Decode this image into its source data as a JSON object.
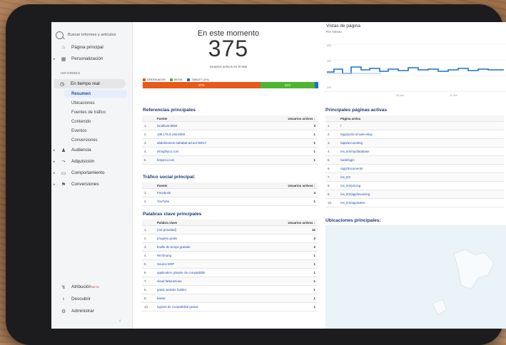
{
  "sidebar": {
    "search_placeholder": "Buscar informes y artículos",
    "home": "Página principal",
    "customization": "Personalización",
    "section_label": "INFORMES",
    "realtime": "En tiempo real",
    "realtime_sub": [
      "Resumen",
      "Ubicaciones",
      "Fuentes de tráfico",
      "Contenido",
      "Eventos",
      "Conversiones"
    ],
    "audience": "Audiencia",
    "acquisition": "Adquisición",
    "behavior": "Comportamiento",
    "conversions": "Conversiones",
    "attribution": "Atribución",
    "attribution_badge": "BETA",
    "discover": "Descubrir",
    "admin": "Administrar"
  },
  "realtime": {
    "title": "En este momento",
    "active_users": "375",
    "caption": "usuarios activos en el sitio",
    "devices": [
      {
        "label": "ORDENADOR",
        "color": "#e8591a",
        "percent": 67,
        "percent_label": "67%"
      },
      {
        "label": "MÓVIL",
        "color": "#50b432",
        "percent": 31,
        "percent_label": "31%"
      },
      {
        "label": "TABLET (2%)",
        "color": "#1a73c9",
        "percent": 2,
        "percent_label": ""
      }
    ]
  },
  "pageviews": {
    "title": "Vistas de página",
    "subtitle": "Por minuto",
    "y_ticks": [
      "600",
      "400",
      "200"
    ],
    "x_ticks": [
      "-20 min",
      "-11 min"
    ],
    "line_color": "#1a73c9"
  },
  "referrals": {
    "title": "Referencias principales",
    "col_source": "Fuente",
    "col_users": "Usuarios activos ↓",
    "rows": [
      {
        "n": "1.",
        "name": "localhost:8069",
        "v": "3"
      },
      {
        "n": "2.",
        "name": "108.175.8.166:8069",
        "v": "1"
      },
      {
        "n": "3.",
        "name": "abdulmonem.sahabat-ad.net:30017",
        "v": "1"
      },
      {
        "n": "4.",
        "name": "elmightyco.com",
        "v": "1"
      },
      {
        "n": "5.",
        "name": "bmperu.com",
        "v": "1"
      }
    ]
  },
  "social": {
    "title": "Tráfico social principal:",
    "col_source": "Fuente",
    "col_users": "Usuarios activos ↓",
    "rows": [
      {
        "n": "1.",
        "name": "Facebook",
        "v": "4"
      },
      {
        "n": "2.",
        "name": "YouTube",
        "v": "1"
      }
    ]
  },
  "keywords": {
    "title": "Palabras clave principales",
    "col_key": "Palabra clave",
    "col_users": "Usuarios activos ↓",
    "rows": [
      {
        "n": "1.",
        "name": "(not provided)",
        "v": "12"
      },
      {
        "n": "2.",
        "name": "progetto gratis",
        "v": "3"
      },
      {
        "n": "3.",
        "name": "feuille de temps gratuite",
        "v": "2"
      },
      {
        "n": "4.",
        "name": "Rechnung",
        "v": "1"
      },
      {
        "n": "5.",
        "name": "Source ERP",
        "v": "1"
      },
      {
        "n": "6.",
        "name": "application gratuite de comptabilité",
        "v": "1"
      },
      {
        "n": "7.",
        "name": "cloud fatturazione",
        "v": "1"
      },
      {
        "n": "8.",
        "name": "gratis website builder",
        "v": "1"
      },
      {
        "n": "9.",
        "name": "kassa",
        "v": "1"
      },
      {
        "n": "10.",
        "name": "logiciel de comptabilité gratuit",
        "v": "1"
      }
    ]
  },
  "pages": {
    "title": "Principales páginas activas",
    "col_page": "Página activa",
    "rows": [
      {
        "n": "1.",
        "name": "/"
      },
      {
        "n": "2.",
        "name": "/app/point-of-sale-shop"
      },
      {
        "n": "3.",
        "name": "/app/accounting"
      },
      {
        "n": "4.",
        "name": "/es_ES/my/database"
      },
      {
        "n": "5.",
        "name": "/web/login"
      },
      {
        "n": "6.",
        "name": "/app/documents"
      },
      {
        "n": "7.",
        "name": "/es_ES"
      },
      {
        "n": "8.",
        "name": "/es_ES/pricing"
      },
      {
        "n": "9.",
        "name": "/es_ES/app/invoicing"
      },
      {
        "n": "10.",
        "name": "/es_ES/app/sales"
      }
    ]
  },
  "locations": {
    "title": "Ubicaciones principales:"
  }
}
